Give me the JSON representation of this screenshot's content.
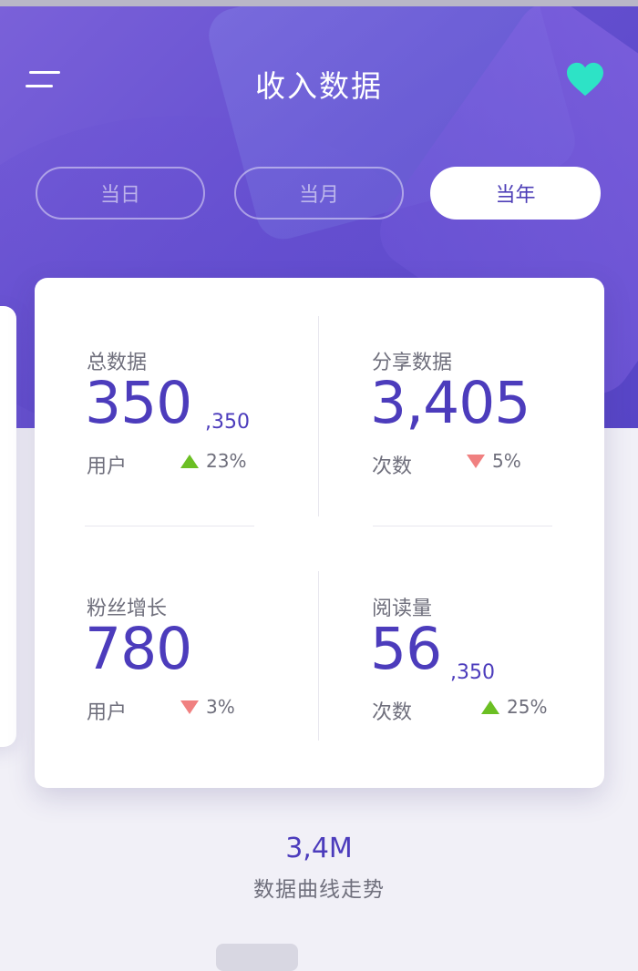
{
  "header": {
    "title": "收入数据",
    "icons": {
      "menu": "menu-icon",
      "favorite": "heart-icon"
    },
    "colors": {
      "gradient_start": "#7a61d9",
      "gradient_end": "#5745c6",
      "heart": "#2de3c6"
    }
  },
  "segments": [
    {
      "label": "当日",
      "active": false
    },
    {
      "label": "当月",
      "active": false
    },
    {
      "label": "当年",
      "active": true
    }
  ],
  "stats": [
    {
      "label": "总数据",
      "value": "350",
      "suffix": ",350",
      "unit": "用户",
      "trend_dir": "up",
      "trend": "23%"
    },
    {
      "label": "分享数据",
      "value": "3,405",
      "suffix": "",
      "unit": "次数",
      "trend_dir": "down",
      "trend": "5%"
    },
    {
      "label": "粉丝增长",
      "value": "780",
      "suffix": "",
      "unit": "用户",
      "trend_dir": "down",
      "trend": "3%"
    },
    {
      "label": "阅读量",
      "value": "56",
      "suffix": ",350",
      "unit": "次数",
      "trend_dir": "up",
      "trend": "25%"
    }
  ],
  "summary": {
    "value": "3,4M",
    "label": "数据曲线走势"
  },
  "colors": {
    "accent": "#4c3cbc",
    "up": "#6bbf23",
    "down": "#f08080"
  }
}
